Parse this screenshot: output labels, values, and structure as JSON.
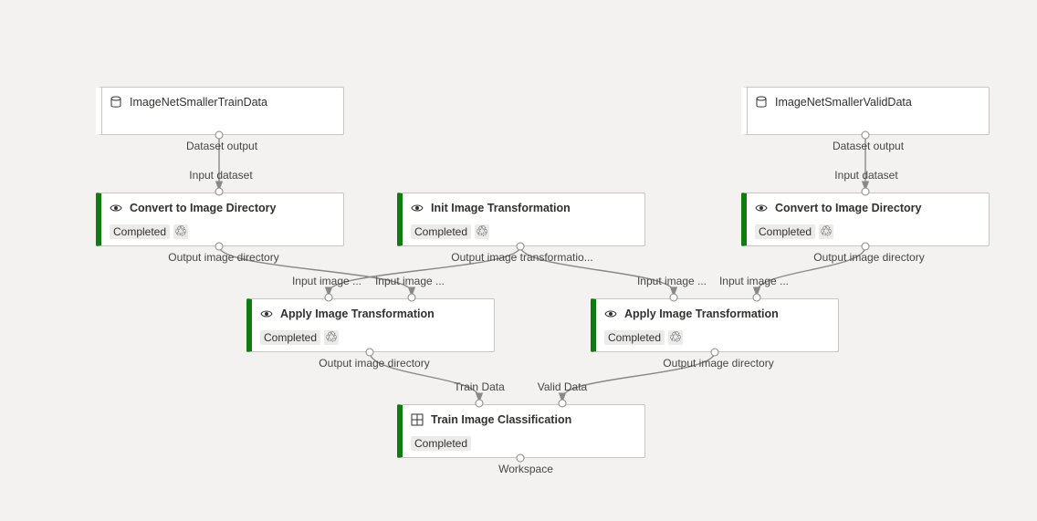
{
  "nodes": {
    "train_data": {
      "title": "ImageNetSmallerTrainData",
      "icon": "dataset-icon"
    },
    "valid_data": {
      "title": "ImageNetSmallerValidData",
      "icon": "dataset-icon"
    },
    "convert_left": {
      "title": "Convert to Image Directory",
      "status": "Completed",
      "icon": "eye-icon"
    },
    "init_transform": {
      "title": "Init Image Transformation",
      "status": "Completed",
      "icon": "eye-icon"
    },
    "convert_right": {
      "title": "Convert to Image Directory",
      "status": "Completed",
      "icon": "eye-icon"
    },
    "apply_left": {
      "title": "Apply Image Transformation",
      "status": "Completed",
      "icon": "eye-icon"
    },
    "apply_right": {
      "title": "Apply Image Transformation",
      "status": "Completed",
      "icon": "eye-icon"
    },
    "train_classification": {
      "title": "Train Image Classification",
      "status": "Completed",
      "icon": "module-grid-icon"
    }
  },
  "ports": {
    "train_data_out": "Dataset output",
    "valid_data_out": "Dataset output",
    "convert_left_in": "Input dataset",
    "convert_right_in": "Input dataset",
    "convert_left_out": "Output image directory",
    "init_transform_out": "Output image transformatio...",
    "convert_right_out": "Output image directory",
    "apply_left_in1": "Input image ...",
    "apply_left_in2": "Input image ...",
    "apply_right_in1": "Input image ...",
    "apply_right_in2": "Input image ...",
    "apply_left_out": "Output image directory",
    "apply_right_out": "Output image directory",
    "train_in1": "Train Data",
    "train_in2": "Valid Data",
    "train_out": "Workspace"
  },
  "colors": {
    "completed_accent": "#107c10",
    "edge": "#8a8886",
    "canvas": "#f3f2f1"
  }
}
